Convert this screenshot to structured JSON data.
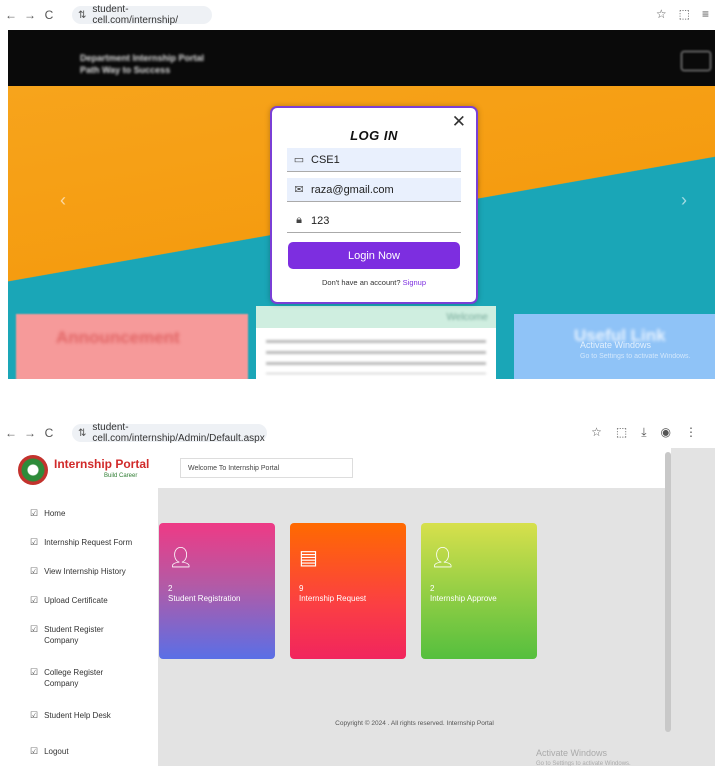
{
  "colors": {
    "accent": "#7d2ee0",
    "hero_orange": "#f7a41c",
    "hero_teal": "#1aa6b7",
    "announcement": "#f69a9a",
    "useful_link": "#8fc3f7",
    "tile_registration": "#ee3a85",
    "tile_request": "#ff6a00",
    "tile_approve": "#95cf45"
  },
  "browser1": {
    "url": "student-cell.com/internship/",
    "icons": [
      "back-icon",
      "forward-icon",
      "reload-icon",
      "site-info-icon",
      "star-icon",
      "extensions-icon",
      "reading-list-icon"
    ]
  },
  "hero": {
    "brand_line1": "Department Internship Portal",
    "brand_line2": "Path Way to Success",
    "cards": {
      "announcement": "Announcement",
      "welcome": "Welcome",
      "useful": "Useful Link"
    }
  },
  "login": {
    "title": "LOG IN",
    "username": "CSE1",
    "email": "raza@gmail.com",
    "password": "123",
    "button": "Login Now",
    "signup_prompt": "Don't have an account?",
    "signup_link": "Signup"
  },
  "activate": {
    "title": "Activate Windows",
    "subtitle": "Go to Settings to activate Windows."
  },
  "browser2": {
    "url": "student-cell.com/internship/Admin/Default.aspx",
    "icons": [
      "star-icon",
      "extensions-icon",
      "download-icon",
      "profile-icon",
      "menu-icon"
    ]
  },
  "admin": {
    "logo_title": "Internship Portal",
    "logo_subtitle": "Build Career",
    "welcome": "Welcome To Internship Portal",
    "nav": [
      {
        "label": "Home"
      },
      {
        "label": "Internship Request Form"
      },
      {
        "label": "View Internship History"
      },
      {
        "label": "Upload Certificate"
      },
      {
        "label": "Student Register Company"
      },
      {
        "label": "College Register Company"
      },
      {
        "label": "Student Help Desk"
      },
      {
        "label": "Logout"
      }
    ],
    "tiles": [
      {
        "count": "2",
        "label": "Student Registration",
        "icon": "user-icon"
      },
      {
        "count": "9",
        "label": "Internship Request",
        "icon": "calendar-icon"
      },
      {
        "count": "2",
        "label": "Internship Approve",
        "icon": "user-icon"
      }
    ],
    "copyright": "Copyright © 2024 . All rights reserved. Internship Portal"
  }
}
